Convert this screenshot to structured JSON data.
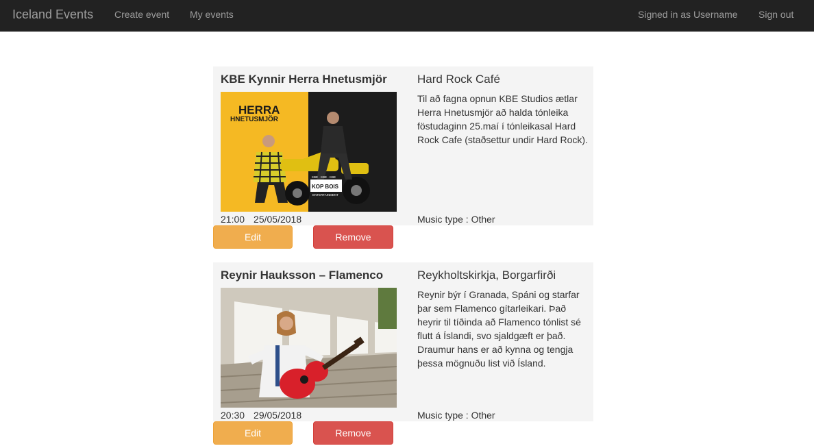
{
  "navbar": {
    "brand": "Iceland Events",
    "links": {
      "create_event": "Create event",
      "my_events": "My events"
    },
    "signed_in": "Signed in as Username",
    "sign_out": "Sign out"
  },
  "events": [
    {
      "title": "KBE Kynnir Herra Hnetusmjör",
      "location": "Hard Rock Café",
      "description": "Til að fagna opnun KBE Studios ætlar Herra Hnetusmjör að halda tónleika föstudaginn 25.maí í tónleikasal Hard Rock Cafe (staðsettur undir Hard Rock).",
      "time": "21:00",
      "date": "25/05/2018",
      "music_type": "Music type : Other",
      "poster_text": [
        "HERRA",
        "HNETUSMJÖR",
        "KBE · KBE · KBE",
        "KOP BOIS",
        "ENTERTAINMENT"
      ],
      "edit_label": "Edit",
      "remove_label": "Remove"
    },
    {
      "title": "Reynir Hauksson – Flamenco",
      "location": "Reykholtskirkja, Borgarfirði",
      "description": "Reynir býr í Granada, Spáni og starfar þar sem Flamenco gítarleikari. Það heyrir til tíðinda að Flamenco tónlist sé flutt á Íslandi, svo sjaldgæft er það. Draumur hans er að kynna og tengja þessa mögnuðu list við Ísland.",
      "time": "20:30",
      "date": "29/05/2018",
      "music_type": "Music type : Other",
      "edit_label": "Edit",
      "remove_label": "Remove"
    }
  ],
  "colors": {
    "navbar_bg": "#222222",
    "nav_text": "#9d9d9d",
    "card_bg": "#f4f4f4",
    "edit_button": "#f0ad4e",
    "remove_button": "#d9534f",
    "poster_yellow": "#f5b923",
    "guitar_red": "#d8202a"
  }
}
